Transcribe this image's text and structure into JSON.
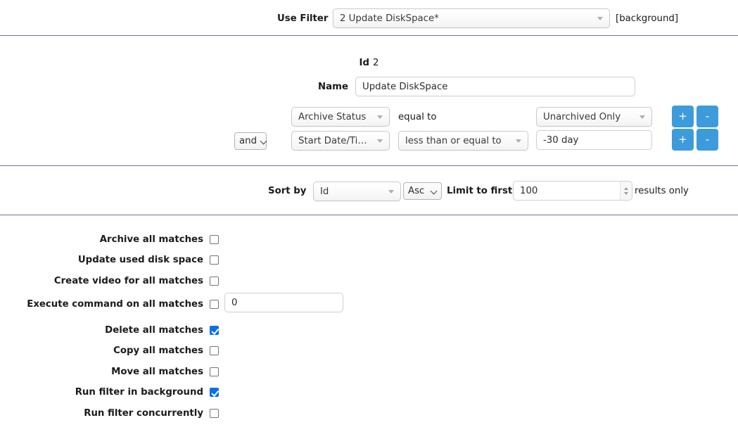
{
  "top_bar": {
    "use_filter_label": "Use Filter",
    "filter_select_value": "2 Update DiskSpace*",
    "background_tag": "[background]"
  },
  "identity": {
    "id_label": "Id",
    "id_value": "2",
    "name_label": "Name",
    "name_value": "Update DiskSpace"
  },
  "conditions": [
    {
      "conjunction": "",
      "field": "Archive Status",
      "operator_text": "equal to",
      "operator_is_select": false,
      "value": "Unarchived Only",
      "value_is_select": true,
      "add_label": "+",
      "remove_label": "-"
    },
    {
      "conjunction": "and",
      "field": "Start Date/Time",
      "operator_text": "less than or equal to",
      "operator_is_select": true,
      "value": "-30 day",
      "value_is_select": false,
      "add_label": "+",
      "remove_label": "-"
    }
  ],
  "sort": {
    "sort_by_label": "Sort by",
    "sort_field": "Id",
    "sort_direction": "Asc",
    "limit_label": "Limit to first",
    "limit_value": "100",
    "results_suffix": "results only"
  },
  "actions": [
    {
      "label": "Archive all matches",
      "checked": false
    },
    {
      "label": "Update used disk space",
      "checked": false
    },
    {
      "label": "Create video for all matches",
      "checked": false
    },
    {
      "label": "Execute command on all matches",
      "checked": false
    },
    {
      "label": "Delete all matches",
      "checked": true
    },
    {
      "label": "Copy all matches",
      "checked": false
    },
    {
      "label": "Move all matches",
      "checked": false
    },
    {
      "label": "Run filter in background",
      "checked": true
    },
    {
      "label": "Run filter concurrently",
      "checked": false
    }
  ],
  "command_input": {
    "value": "0"
  },
  "colors": {
    "accent_blue": "#3d9bdc",
    "checkbox_blue": "#0b6fe8",
    "divider": "#6f6f9c"
  }
}
